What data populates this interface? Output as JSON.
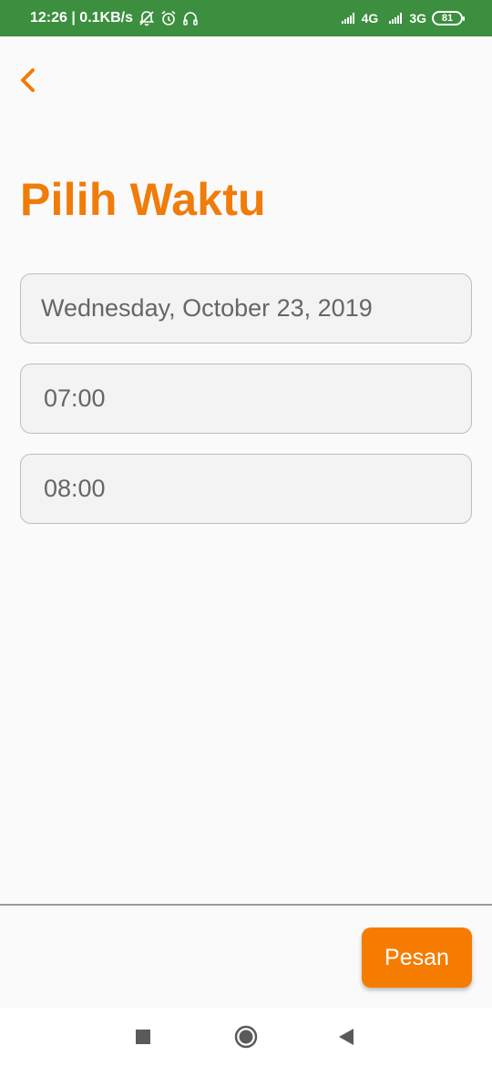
{
  "status_bar": {
    "time_speed": "12:26 | 0.1KB/s",
    "network_1": "4G",
    "network_2": "3G",
    "battery": "81",
    "icons": [
      "muted-bell-icon",
      "alarm-icon",
      "headphones-icon",
      "signal-icon",
      "battery-icon"
    ]
  },
  "header": {
    "back_icon": "chevron-left-icon"
  },
  "page": {
    "title": "Pilih Waktu"
  },
  "fields": {
    "date": "Wednesday, October 23, 2019",
    "start_time": "07:00",
    "end_time": "08:00"
  },
  "actions": {
    "order_label": "Pesan"
  },
  "nav": {
    "icons": [
      "recent-apps-icon",
      "home-icon",
      "back-icon"
    ]
  },
  "colors": {
    "status_bar": "#3b8f3e",
    "accent": "#f07c0a",
    "button": "#f57c00"
  }
}
